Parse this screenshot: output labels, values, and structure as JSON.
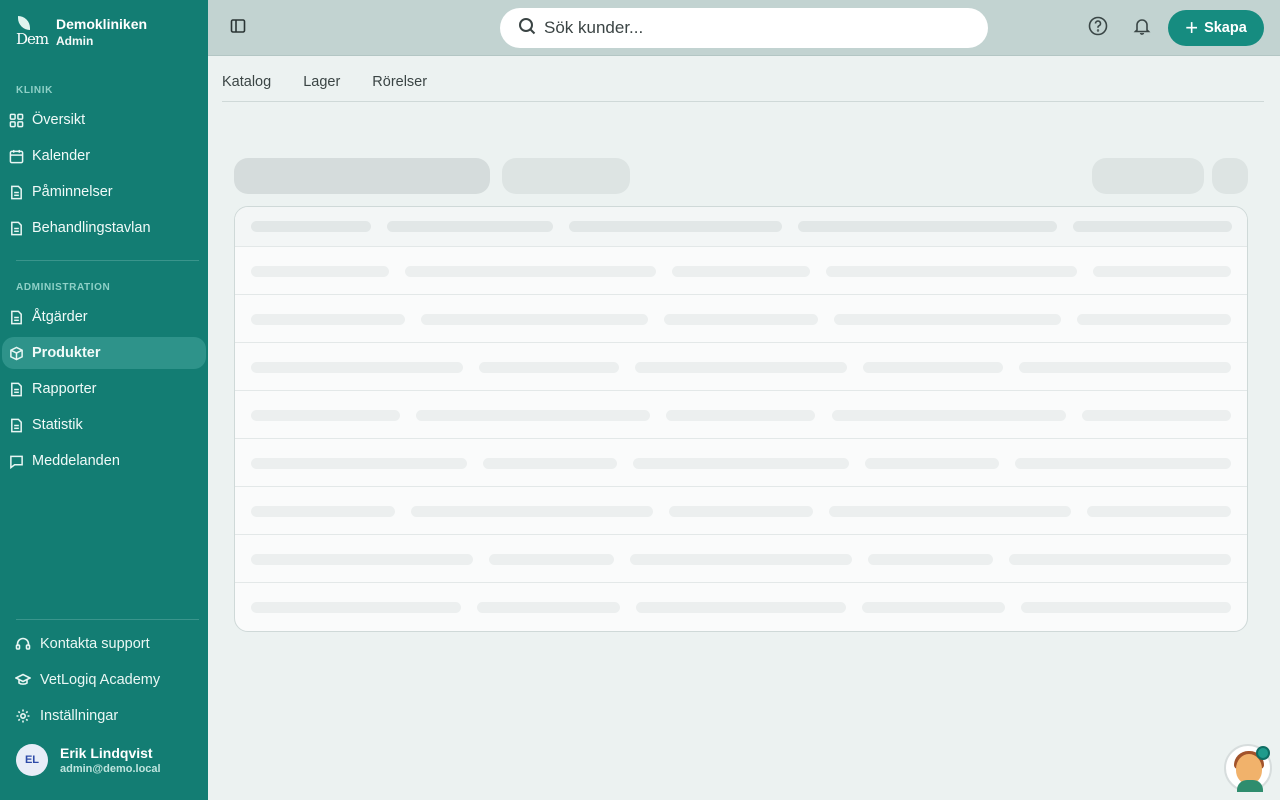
{
  "brand": {
    "name": "Demokliniken",
    "role": "Admin",
    "logo_text": "Dem"
  },
  "sidebar": {
    "section_clinic": "KLINIK",
    "clinic_items": [
      {
        "label": "Översikt",
        "icon": "grid-icon"
      },
      {
        "label": "Kalender",
        "icon": "calendar-icon"
      },
      {
        "label": "Påminnelser",
        "icon": "document-icon"
      },
      {
        "label": "Behandlingstavlan",
        "icon": "document-icon"
      }
    ],
    "section_admin": "ADMINISTRATION",
    "admin_items": [
      {
        "label": "Åtgärder",
        "icon": "document-icon"
      },
      {
        "label": "Produkter",
        "icon": "box-icon",
        "active": true
      },
      {
        "label": "Rapporter",
        "icon": "document-icon"
      },
      {
        "label": "Statistik",
        "icon": "document-icon"
      },
      {
        "label": "Meddelanden",
        "icon": "chat-icon"
      }
    ],
    "bottom_items": [
      {
        "label": "Kontakta support",
        "icon": "headset-icon"
      },
      {
        "label": "VetLogiq Academy",
        "icon": "graduation-cap-icon"
      },
      {
        "label": "Inställningar",
        "icon": "gear-icon"
      }
    ],
    "user": {
      "initials": "EL",
      "name": "Erik Lindqvist",
      "email": "admin@demo.local"
    }
  },
  "topbar": {
    "search_placeholder": "Sök kunder...",
    "create_label": "Skapa",
    "create_plus": "+"
  },
  "tabs": [
    "Katalog",
    "Lager",
    "Rörelser"
  ],
  "colors": {
    "sidebar": "#137d73",
    "accent": "#168c80",
    "active_item": "#2e938a",
    "background": "#ecf2f1"
  }
}
